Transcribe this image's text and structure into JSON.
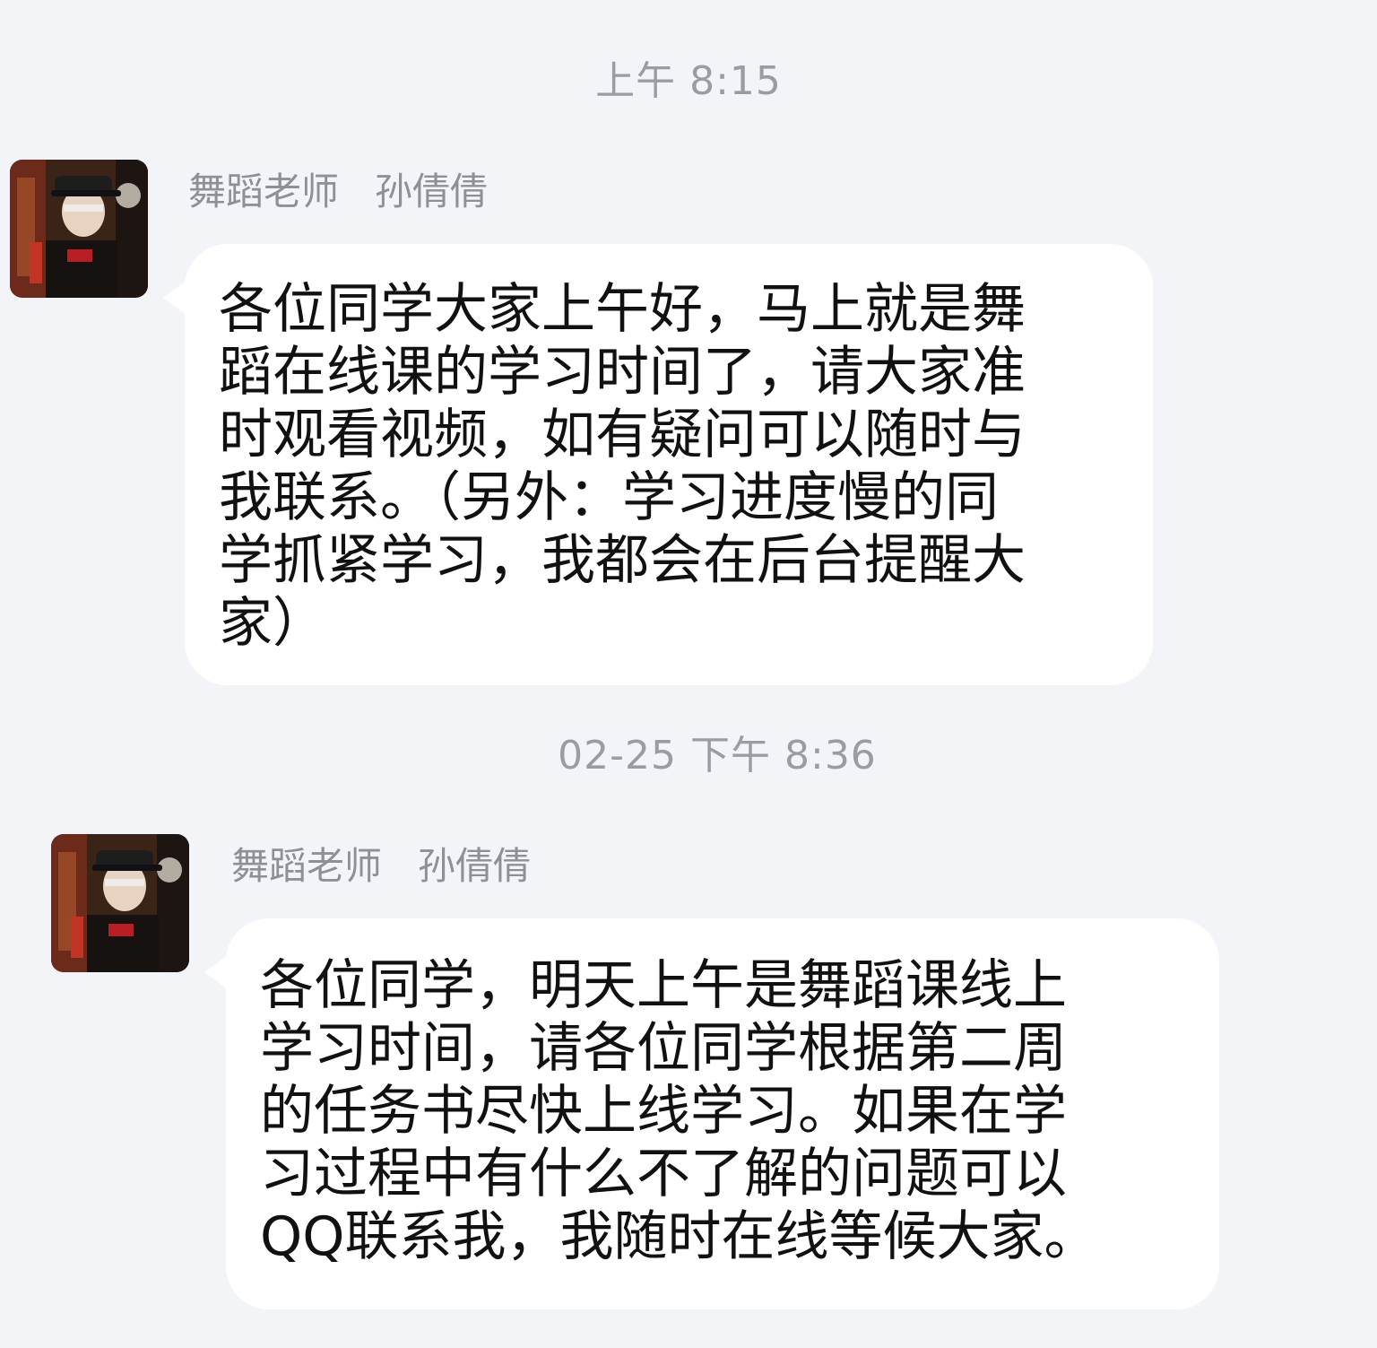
{
  "messages": [
    {
      "timestamp": "上午 8:15",
      "sender_role": "舞蹈老师",
      "sender_name": "孙倩倩",
      "avatar_icon": "user-avatar-photo",
      "text": "各位同学大家上午好，马上就是舞\n蹈在线课的学习时间了，请大家准\n时观看视频，如有疑问可以随时与\n我联系。（另外：学习进度慢的同\n学抓紧学习，我都会在后台提醒大\n家）"
    },
    {
      "timestamp": "02-25 下午 8:36",
      "sender_role": "舞蹈老师",
      "sender_name": "孙倩倩",
      "avatar_icon": "user-avatar-photo",
      "text": "各位同学，明天上午是舞蹈课线上\n学习时间，请各位同学根据第二周\n的任务书尽快上线学习。如果在学\n习过程中有什么不了解的问题可以\nQQ联系我，我随时在线等候大家。"
    }
  ]
}
